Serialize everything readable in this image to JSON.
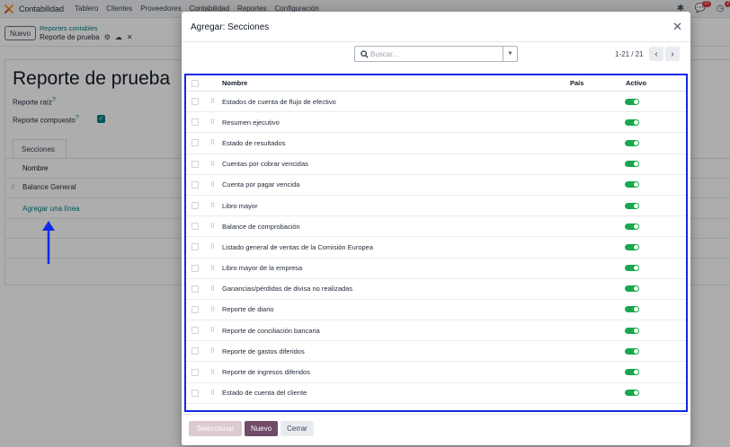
{
  "navbar": {
    "app_name": "Contabilidad",
    "menu": [
      "Tablero",
      "Clientes",
      "Proveedores",
      "Contabilidad",
      "Reportes",
      "Configuración"
    ],
    "messages_badge": "17",
    "activity_badge": "2"
  },
  "control_panel": {
    "new_button": "Nuevo",
    "breadcrumb": "Reportes contables",
    "record": "Reporte de prueba"
  },
  "form": {
    "title": "Reporte de prueba",
    "root_report_label": "Reporte raíz",
    "composite_label": "Reporte compuesto",
    "composite_checked": true,
    "tab_label": "Secciones",
    "column_name": "Nombre",
    "line": "Balance General",
    "add_line": "Agregar una línea"
  },
  "modal": {
    "title": "Agregar: Secciones",
    "search_placeholder": "Buscar...",
    "pager": "1-21 / 21",
    "columns": {
      "name": "Nombre",
      "country": "País",
      "active": "Activo"
    },
    "rows": [
      "Estados de cuenta de flujo de efectivo",
      "Resumen ejecutivo",
      "Estado de resultados",
      "Cuentas por cobrar vencidas",
      "Cuenta por pagar vencida",
      "Libro mayor",
      "Balance de comprobación",
      "Listado general de ventas de la Comisión Europea",
      "Libro mayor de la empresa",
      "Ganancias/pérdidas de divisa no realizadas",
      "Reporte de diario",
      "Reporte de conciliación bancaria",
      "Reporte de gastos diferidos",
      "Reporte de ingresos diferidos",
      "Estado de cuenta del cliente"
    ],
    "buttons": {
      "select": "Seleccionar",
      "new": "Nuevo",
      "close": "Cerrar"
    }
  },
  "colors": {
    "primary": "#714b67",
    "teal": "#017e84",
    "toggle_on": "#17a84b",
    "highlight_border": "#1129e6",
    "annotation_arrow": "#1129e6"
  }
}
